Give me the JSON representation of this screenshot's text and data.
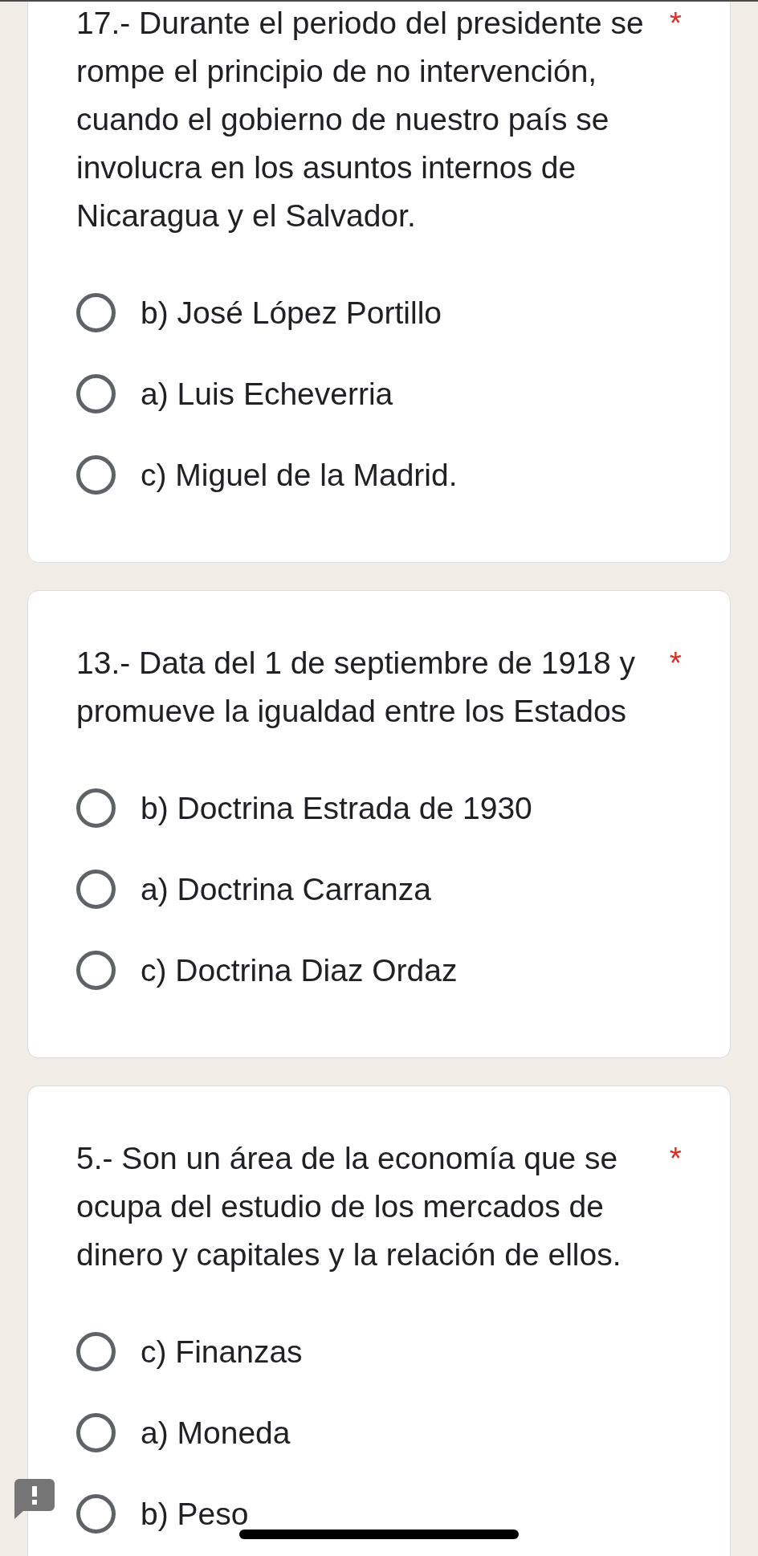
{
  "questions": [
    {
      "title": "17.- Durante el periodo del presidente se rompe el principio de no intervención, cuando el gobierno de nuestro país se involucra en los asuntos internos de Nicaragua y el Salvador.",
      "required_mark": "*",
      "options": [
        {
          "label": "b) José López Portillo",
          "selected": false
        },
        {
          "label": "a) Luis Echeverria",
          "selected": false
        },
        {
          "label": "c) Miguel de la Madrid.",
          "selected": false
        }
      ]
    },
    {
      "title": "13.- Data del 1 de septiembre de 1918 y promueve la igualdad entre los Estados",
      "required_mark": "*",
      "options": [
        {
          "label": "b) Doctrina Estrada de 1930",
          "selected": false
        },
        {
          "label": "a) Doctrina Carranza",
          "selected": false
        },
        {
          "label": "c) Doctrina Diaz Ordaz",
          "selected": false
        }
      ]
    },
    {
      "title": "5.- Son un área de la economía que se ocupa del estudio de los mercados de dinero y capitales y la relación de ellos.",
      "required_mark": "*",
      "options": [
        {
          "label": "c) Finanzas",
          "selected": false
        },
        {
          "label": "a) Moneda",
          "selected": false
        },
        {
          "label": "b) Peso",
          "selected": false
        }
      ]
    }
  ]
}
